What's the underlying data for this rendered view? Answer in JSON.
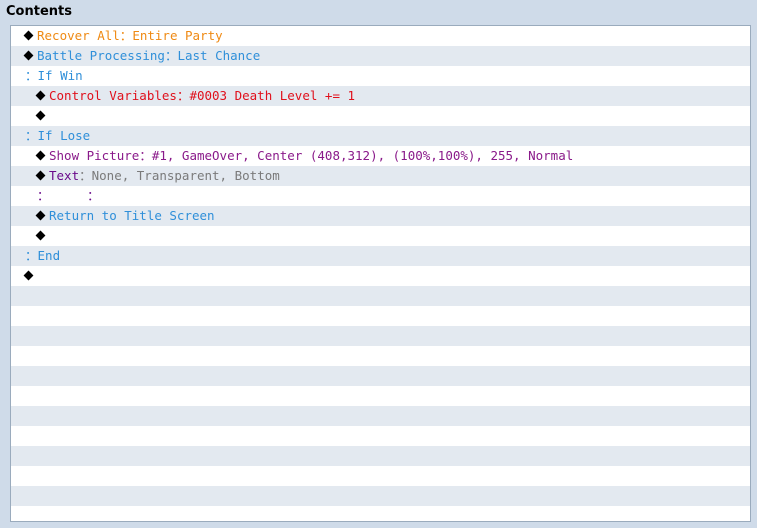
{
  "panel": {
    "title": "Contents"
  },
  "commands": [
    {
      "indent": 0,
      "marker": "diamond",
      "parts": [
        {
          "text": "Recover All",
          "color": "#ef8a14"
        },
        {
          "text": "：",
          "color": "#ef8a14"
        },
        {
          "text": "Entire Party",
          "color": "#ef8a14"
        }
      ]
    },
    {
      "indent": 0,
      "marker": "diamond",
      "parts": [
        {
          "text": "Battle Processing",
          "color": "#2f8fd9"
        },
        {
          "text": "：",
          "color": "#2f8fd9"
        },
        {
          "text": "Last Chance",
          "color": "#2f8fd9"
        }
      ]
    },
    {
      "indent": 0,
      "marker": "colon",
      "parts": [
        {
          "text": "：",
          "color": "#2f8fd9"
        },
        {
          "text": "If Win",
          "color": "#2f8fd9"
        }
      ]
    },
    {
      "indent": 1,
      "marker": "diamond",
      "parts": [
        {
          "text": "Control Variables",
          "color": "#e0101c"
        },
        {
          "text": "：",
          "color": "#e0101c"
        },
        {
          "text": "#0003 Death Level += 1",
          "color": "#e0101c"
        }
      ]
    },
    {
      "indent": 1,
      "marker": "diamond",
      "parts": []
    },
    {
      "indent": 0,
      "marker": "colon",
      "parts": [
        {
          "text": "：",
          "color": "#2f8fd9"
        },
        {
          "text": "If Lose",
          "color": "#2f8fd9"
        }
      ]
    },
    {
      "indent": 1,
      "marker": "diamond",
      "parts": [
        {
          "text": "Show Picture",
          "color": "#8a1a8a"
        },
        {
          "text": "：",
          "color": "#8a1a8a"
        },
        {
          "text": "#1, GameOver, Center (408,312), (100%,100%), 255, Normal",
          "color": "#8a1a8a"
        }
      ]
    },
    {
      "indent": 1,
      "marker": "diamond",
      "parts": [
        {
          "text": "Text",
          "color": "#6a0a8a"
        },
        {
          "text": "：",
          "color": "#7a7a7a"
        },
        {
          "text": "None, Transparent, Bottom",
          "color": "#7a7a7a"
        }
      ]
    },
    {
      "indent": 1,
      "marker": "colon",
      "parts": [
        {
          "text": "：",
          "color": "#6a0a8a"
        },
        {
          "text": "     ：",
          "color": "#6a0a8a"
        }
      ]
    },
    {
      "indent": 1,
      "marker": "diamond",
      "parts": [
        {
          "text": "Return to Title Screen",
          "color": "#2f8fd9"
        }
      ]
    },
    {
      "indent": 1,
      "marker": "diamond",
      "parts": []
    },
    {
      "indent": 0,
      "marker": "colon",
      "parts": [
        {
          "text": "：",
          "color": "#2f8fd9"
        },
        {
          "text": "End",
          "color": "#2f8fd9"
        }
      ]
    },
    {
      "indent": 0,
      "marker": "diamond",
      "parts": []
    }
  ],
  "empty_rows": 12
}
